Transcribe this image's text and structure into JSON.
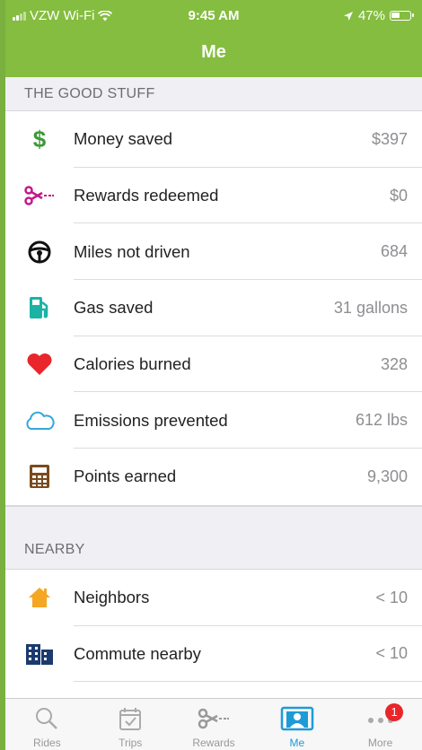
{
  "status_bar": {
    "carrier": "VZW Wi-Fi",
    "time": "9:45 AM",
    "battery": "47%",
    "battery_level": 0.47
  },
  "nav": {
    "title": "Me"
  },
  "sections": {
    "good_stuff": {
      "title": "THE GOOD STUFF",
      "rows": [
        {
          "icon": "dollar-icon",
          "label": "Money saved",
          "value": "$397"
        },
        {
          "icon": "scissors-icon",
          "label": "Rewards redeemed",
          "value": "$0"
        },
        {
          "icon": "steering-wheel-icon",
          "label": "Miles not driven",
          "value": "684"
        },
        {
          "icon": "gas-pump-icon",
          "label": "Gas saved",
          "value": "31 gallons"
        },
        {
          "icon": "heart-icon",
          "label": "Calories burned",
          "value": "328"
        },
        {
          "icon": "cloud-icon",
          "label": "Emissions prevented",
          "value": "612 lbs"
        },
        {
          "icon": "calculator-icon",
          "label": "Points earned",
          "value": "9,300"
        }
      ]
    },
    "nearby": {
      "title": "NEARBY",
      "rows": [
        {
          "icon": "house-icon",
          "label": "Neighbors",
          "value": "< 10"
        },
        {
          "icon": "building-icon",
          "label": "Commute nearby",
          "value": "< 10"
        }
      ]
    }
  },
  "tabs": [
    {
      "icon": "search-icon",
      "label": "Rides"
    },
    {
      "icon": "calendar-check-icon",
      "label": "Trips"
    },
    {
      "icon": "scissors-icon",
      "label": "Rewards"
    },
    {
      "icon": "profile-card-icon",
      "label": "Me"
    },
    {
      "icon": "more-dots-icon",
      "label": "More",
      "badge": "1"
    }
  ],
  "colors": {
    "brand_green": "#84bd3f",
    "active_tab": "#1e9bd7",
    "badge_red": "#e8262b"
  }
}
